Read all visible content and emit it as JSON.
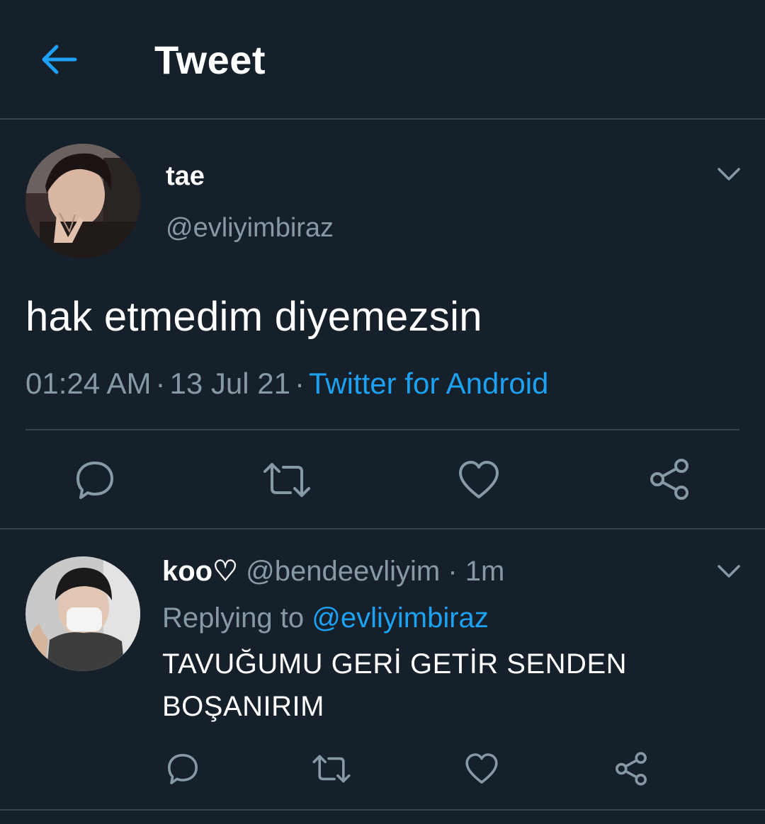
{
  "header": {
    "back_icon": "arrow-left-icon",
    "title": "Tweet"
  },
  "tweet": {
    "author_name": "tae",
    "author_handle": "@evliyimbiraz",
    "text": "hak etmedim diyemezsin",
    "time": "01:24 AM",
    "date": "13 Jul 21",
    "separator": "·",
    "source": "Twitter for Android",
    "menu_icon": "chevron-down-icon"
  },
  "actions": {
    "reply_icon": "reply-icon",
    "retweet_icon": "retweet-icon",
    "like_icon": "heart-icon",
    "share_icon": "share-icon"
  },
  "reply": {
    "author_name": "koo♡",
    "author_handle": "@bendeevliyim",
    "separator": "·",
    "time": "1m",
    "replying_prefix": "Replying to",
    "replying_handle": "@evliyimbiraz",
    "text": "TAVUĞUMU GERİ GETİR SENDEN BOŞANIRIM",
    "menu_icon": "chevron-down-icon"
  },
  "colors": {
    "background": "#15202b",
    "divider": "#38444d",
    "accent": "#1da1f2",
    "secondary_text": "#8899a6",
    "primary_text": "#ffffff"
  }
}
